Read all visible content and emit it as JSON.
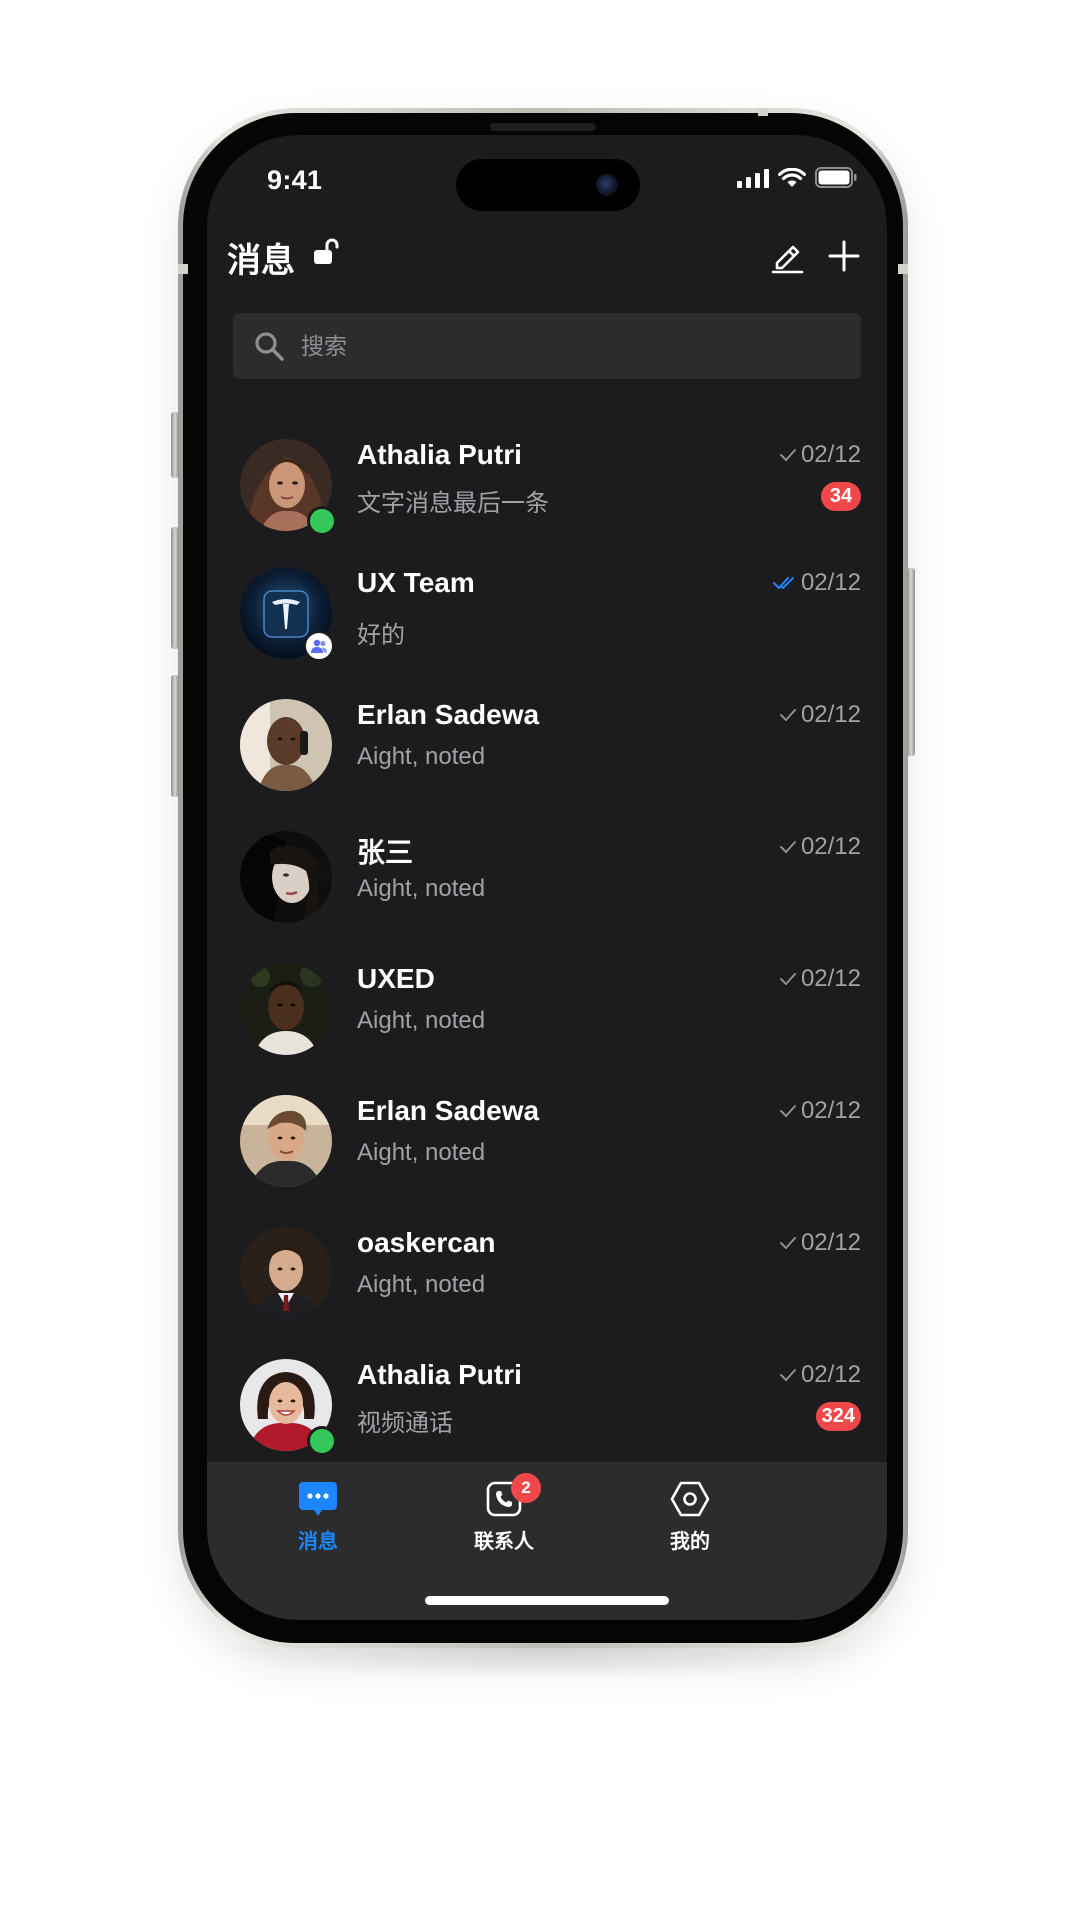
{
  "status_bar": {
    "time": "9:41"
  },
  "header": {
    "title": "消息"
  },
  "search": {
    "placeholder": "搜索"
  },
  "colors": {
    "accent": "#1d86ff",
    "badge": "#f0484a",
    "online": "#34c759",
    "background": "#1c1c1e"
  },
  "chats": [
    {
      "name": "Athalia Putri",
      "preview": "文字消息最后一条",
      "date": "02/12",
      "read_status": "sent",
      "unread": "34",
      "online": true
    },
    {
      "name": "UX Team",
      "preview": "好的",
      "date": "02/12",
      "read_status": "read",
      "group": true
    },
    {
      "name": "Erlan Sadewa",
      "preview": "Aight, noted",
      "date": "02/12",
      "read_status": "sent"
    },
    {
      "name": "张三",
      "preview": "Aight, noted",
      "date": "02/12",
      "read_status": "sent",
      "locked": true
    },
    {
      "name": "UXED",
      "preview": "Aight, noted",
      "date": "02/12",
      "read_status": "sent"
    },
    {
      "name": "Erlan Sadewa",
      "preview": "Aight, noted",
      "date": "02/12",
      "read_status": "sent"
    },
    {
      "name": "oaskercan",
      "preview": "Aight, noted",
      "date": "02/12",
      "read_status": "sent"
    },
    {
      "name": "Athalia Putri",
      "preview": "视频通话",
      "date": "02/12",
      "read_status": "sent",
      "unread": "324",
      "online": true
    }
  ],
  "tabs": [
    {
      "label": "消息",
      "icon": "chat-bubble-icon",
      "active": true
    },
    {
      "label": "联系人",
      "icon": "phone-icon",
      "badge": "2"
    },
    {
      "label": "我的",
      "icon": "hexagon-settings-icon"
    }
  ]
}
